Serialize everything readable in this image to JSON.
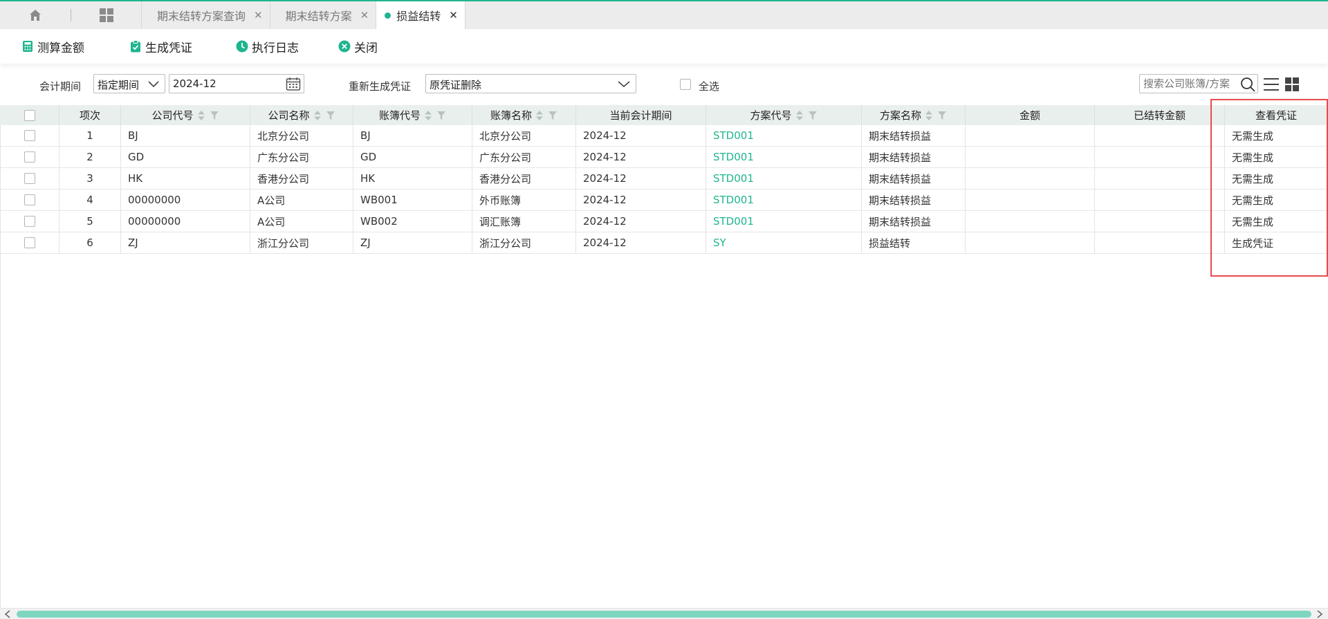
{
  "tabs": [
    {
      "label": "期末结转方案查询"
    },
    {
      "label": "期末结转方案"
    },
    {
      "label": "损益结转"
    }
  ],
  "toolbar": {
    "calc": "测算金额",
    "generate": "生成凭证",
    "log": "执行日志",
    "close": "关闭"
  },
  "filters": {
    "period_label": "会计期间",
    "period_mode": "指定期间",
    "period_value": "2024-12",
    "regen_label": "重新生成凭证",
    "regen_value": "原凭证删除",
    "select_all": "全选",
    "search_placeholder": "搜索公司账簿/方案"
  },
  "colors": {
    "accent": "#1fb58f",
    "highlight": "#e84a4a"
  },
  "table": {
    "headers": {
      "index": "项次",
      "company_code": "公司代号",
      "company_name": "公司名称",
      "book_code": "账簿代号",
      "book_name": "账簿名称",
      "current_period": "当前会计期间",
      "scheme_code": "方案代号",
      "scheme_name": "方案名称",
      "amount": "金额",
      "transferred_amount": "已结转金额",
      "view_voucher": "查看凭证"
    },
    "rows": [
      {
        "index": "1",
        "company_code": "BJ",
        "company_name": "北京分公司",
        "book_code": "BJ",
        "book_name": "北京分公司",
        "period": "2024-12",
        "scheme_code": "STD001",
        "scheme_name": "期末结转损益",
        "amount": "",
        "transferred": "",
        "voucher": "无需生成"
      },
      {
        "index": "2",
        "company_code": "GD",
        "company_name": "广东分公司",
        "book_code": "GD",
        "book_name": "广东分公司",
        "period": "2024-12",
        "scheme_code": "STD001",
        "scheme_name": "期末结转损益",
        "amount": "",
        "transferred": "",
        "voucher": "无需生成"
      },
      {
        "index": "3",
        "company_code": "HK",
        "company_name": "香港分公司",
        "book_code": "HK",
        "book_name": "香港分公司",
        "period": "2024-12",
        "scheme_code": "STD001",
        "scheme_name": "期末结转损益",
        "amount": "",
        "transferred": "",
        "voucher": "无需生成"
      },
      {
        "index": "4",
        "company_code": "00000000",
        "company_name": "A公司",
        "book_code": "WB001",
        "book_name": "外币账簿",
        "period": "2024-12",
        "scheme_code": "STD001",
        "scheme_name": "期末结转损益",
        "amount": "",
        "transferred": "",
        "voucher": "无需生成"
      },
      {
        "index": "5",
        "company_code": "00000000",
        "company_name": "A公司",
        "book_code": "WB002",
        "book_name": "调汇账簿",
        "period": "2024-12",
        "scheme_code": "STD001",
        "scheme_name": "期末结转损益",
        "amount": "",
        "transferred": "",
        "voucher": "无需生成"
      },
      {
        "index": "6",
        "company_code": "ZJ",
        "company_name": "浙江分公司",
        "book_code": "ZJ",
        "book_name": "浙江分公司",
        "period": "2024-12",
        "scheme_code": "SY",
        "scheme_name": "损益结转",
        "amount": "",
        "transferred": "",
        "voucher": "生成凭证"
      }
    ]
  }
}
